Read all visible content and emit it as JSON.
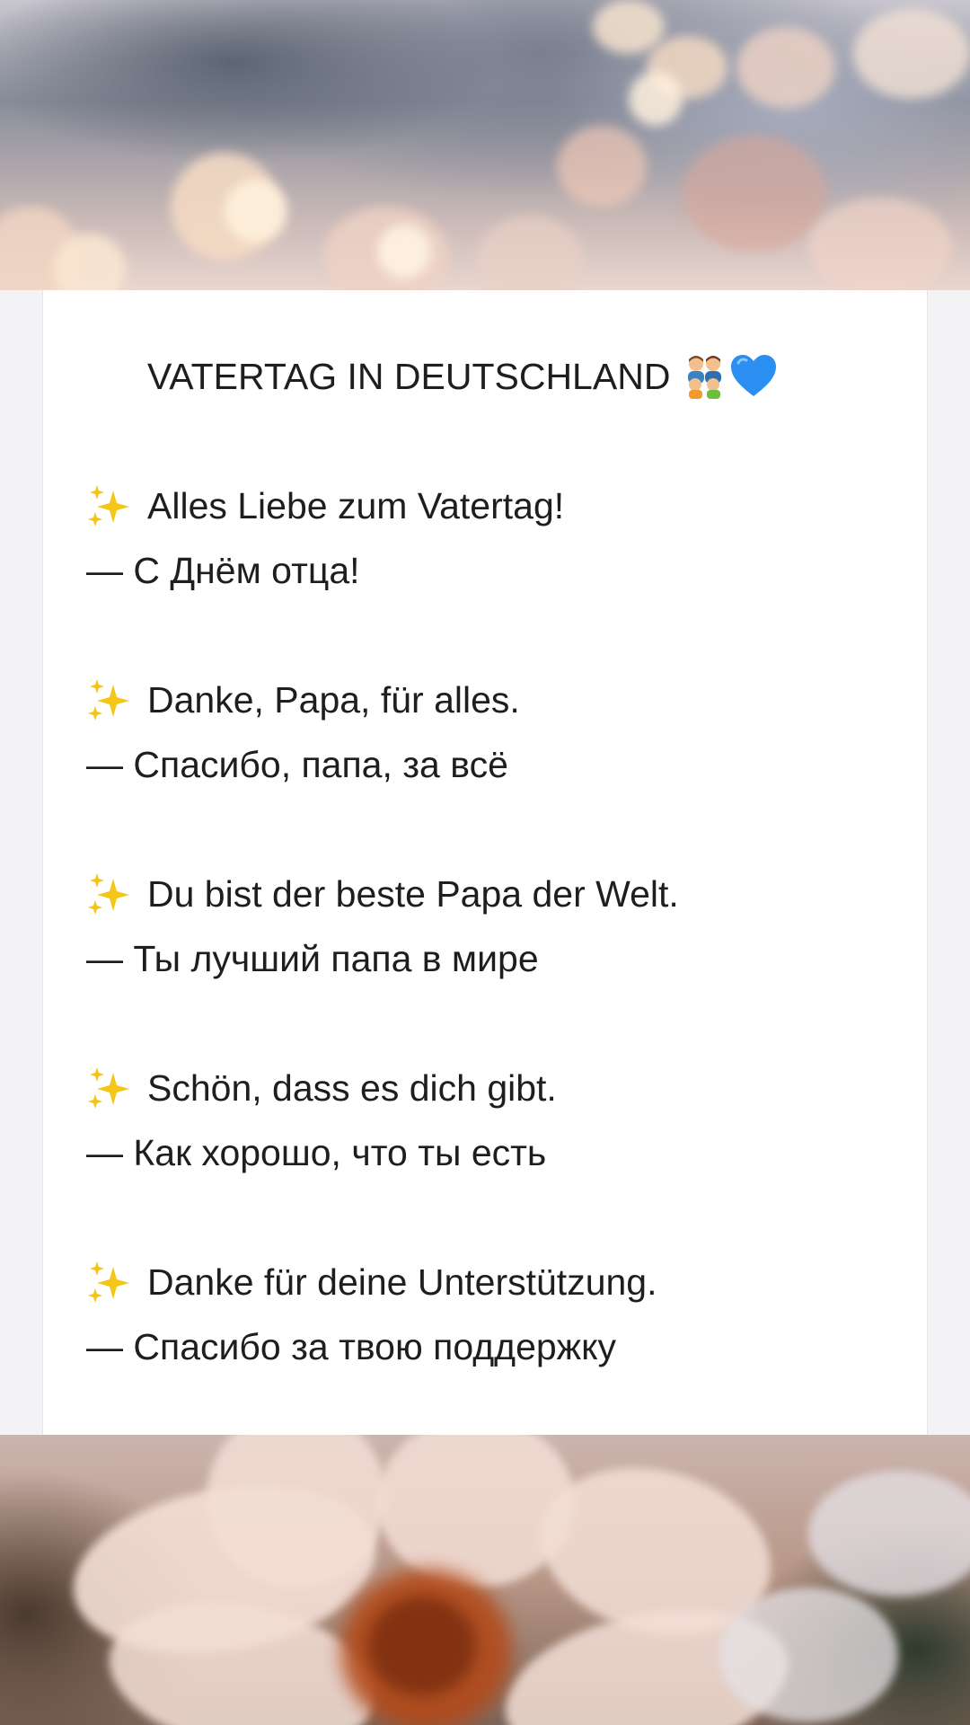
{
  "header": {
    "title": "VATERTAG IN DEUTSCHLAND",
    "icons": [
      "germany-flag-icon",
      "family-icon",
      "blue-heart-icon"
    ]
  },
  "phrases": [
    {
      "de": "Alles Liebe zum Vatertag!",
      "ru": "— С Днём отца!"
    },
    {
      "de": "Danke, Papa, für alles.",
      "ru": "— Спасибо, папа, за всё"
    },
    {
      "de": "Du bist der beste Papa der Welt.",
      "ru": "— Ты лучший папа в мире"
    },
    {
      "de": "Schön, dass es dich gibt.",
      "ru": "— Как хорошо, что ты есть"
    },
    {
      "de": "Danke für deine Unterstützung.",
      "ru": "— Спасибо за твою поддержку"
    }
  ],
  "colors": {
    "text": "#1e1e1e",
    "card": "#ffffff",
    "sparkle": "#f5c518",
    "heart": "#2a8ff0"
  }
}
